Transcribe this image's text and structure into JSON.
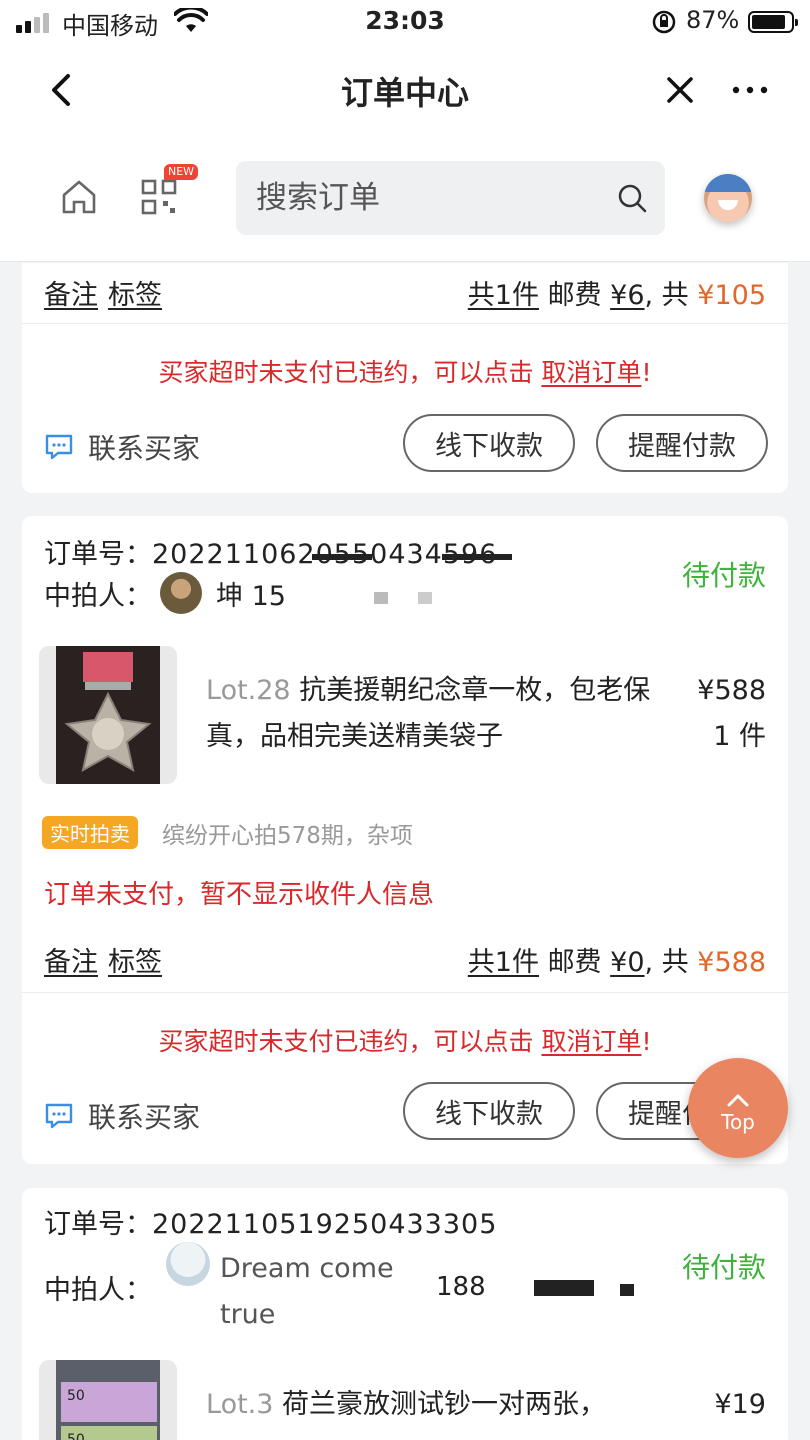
{
  "status_bar": {
    "carrier": "中国移动",
    "time": "23:03",
    "battery": "87%"
  },
  "nav": {
    "title": "订单中心"
  },
  "search": {
    "placeholder": "搜索订单",
    "new_badge": "NEW"
  },
  "labels": {
    "order_no": "订单号：",
    "winner": "中拍人：",
    "note": "备注",
    "tag": "标签",
    "postage": "邮费",
    "contact": "联系买家",
    "offline_pay": "线下收款",
    "remind_pay": "提醒付款",
    "warn_prefix": "买家超时未支付已违约，可以点击",
    "cancel_order": "取消订单",
    "warn_suffix": "!",
    "top": "Top"
  },
  "orders": [
    {
      "count": "共1件",
      "postage": "¥6",
      "total_prefix": ", 共",
      "total": "¥105"
    },
    {
      "order_no": "20221106205504345​96",
      "order_no_visible": "2022110620550434596",
      "winner_name": "坤 15",
      "status": "待付款",
      "lot": "Lot.28",
      "title": "抗美援朝纪念章一枚，包老保真，品相完美送精美袋子",
      "price": "¥588",
      "qty": "1 件",
      "badge": "实时拍卖",
      "session": "缤纷开心拍578期，杂项",
      "unpaid_note": "订单未支付，暂不显示收件人信息",
      "count": "共1件",
      "postage": "¥0",
      "total_prefix": ", 共",
      "total": "¥588"
    },
    {
      "order_no": "2022110519250433305",
      "winner_name_line1": "Dream come",
      "winner_name_line2": "true",
      "winner_phone": "188",
      "status": "待付款",
      "lot": "Lot.3",
      "title": "荷兰豪放测试钞一对两张，",
      "price": "¥19"
    }
  ],
  "colors": {
    "accent_orange": "#e1682a",
    "status_green": "#3cb43c",
    "warn_red": "#d9292a",
    "fab": "#e98561"
  }
}
